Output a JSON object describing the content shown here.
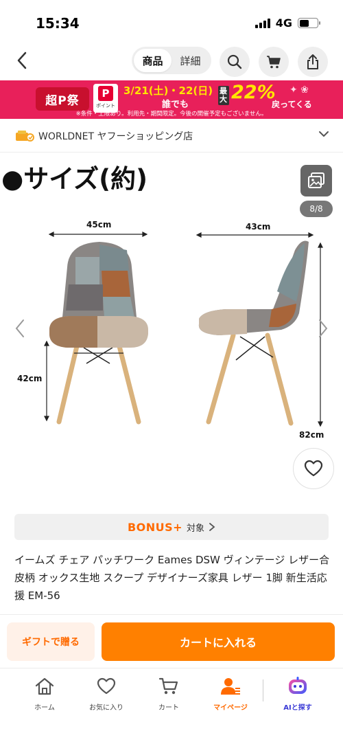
{
  "status_bar": {
    "time": "15:34",
    "network": "4G",
    "signal_icon": "cellular-signal-icon",
    "battery_icon": "battery-icon",
    "battery_level": 0.55
  },
  "header": {
    "back_icon": "chevron-left-icon",
    "tabs": [
      {
        "label": "商品",
        "active": true
      },
      {
        "label": "詳細",
        "active": false
      }
    ],
    "search_icon": "search-icon",
    "cart_icon": "cart-icon",
    "share_icon": "share-icon"
  },
  "banner": {
    "event_name": "超P祭",
    "point_label": "ポイント",
    "point_mark": "P",
    "dates": "3/21(土)・22(日)",
    "anyone": "誰でも",
    "max_label": "最大",
    "percent": "22%",
    "back_text": "戻ってくる",
    "note": "※条件・上限あり。利用先・期間限定。今後の開催予定もございません。",
    "colors": {
      "background": "#e8205a",
      "accent": "#ffe600"
    }
  },
  "store": {
    "icon": "store-badge-icon",
    "name": "WORLDNET ヤフーショッピング店",
    "chevron_icon": "chevron-down-icon"
  },
  "product_image": {
    "heading": "●サイズ(約)",
    "width_front": "45cm",
    "width_side": "43cm",
    "seat_height": "42cm",
    "total_height": "82cm",
    "gallery_icon": "gallery-icon",
    "page_counter": "8/8",
    "prev_icon": "chevron-left-icon",
    "next_icon": "chevron-right-icon",
    "favorite_icon": "heart-icon"
  },
  "bonus": {
    "logo": "BONUS+",
    "target_label": "対象",
    "chevron_icon": "chevron-right-icon"
  },
  "product": {
    "title": "イームズ チェア パッチワーク Eames DSW ヴィンテージ レザー合皮柄 オックス生地 スクープ デザイナーズ家具 レザー 1脚 新生活応援 EM-56"
  },
  "actions": {
    "gift_label": "ギフトで贈る",
    "cart_label": "カートに入れる",
    "colors": {
      "primary": "#ff8000",
      "gift_bg": "#fff1e8"
    }
  },
  "tabbar": {
    "items": [
      {
        "label": "ホーム",
        "icon": "home-icon",
        "active": false
      },
      {
        "label": "お気に入り",
        "icon": "heart-outline-icon",
        "active": false
      },
      {
        "label": "カート",
        "icon": "cart-icon",
        "active": false
      },
      {
        "label": "マイページ",
        "icon": "user-icon",
        "active": true
      },
      {
        "label": "AIと探す",
        "icon": "ai-robot-icon",
        "active": false
      }
    ]
  }
}
